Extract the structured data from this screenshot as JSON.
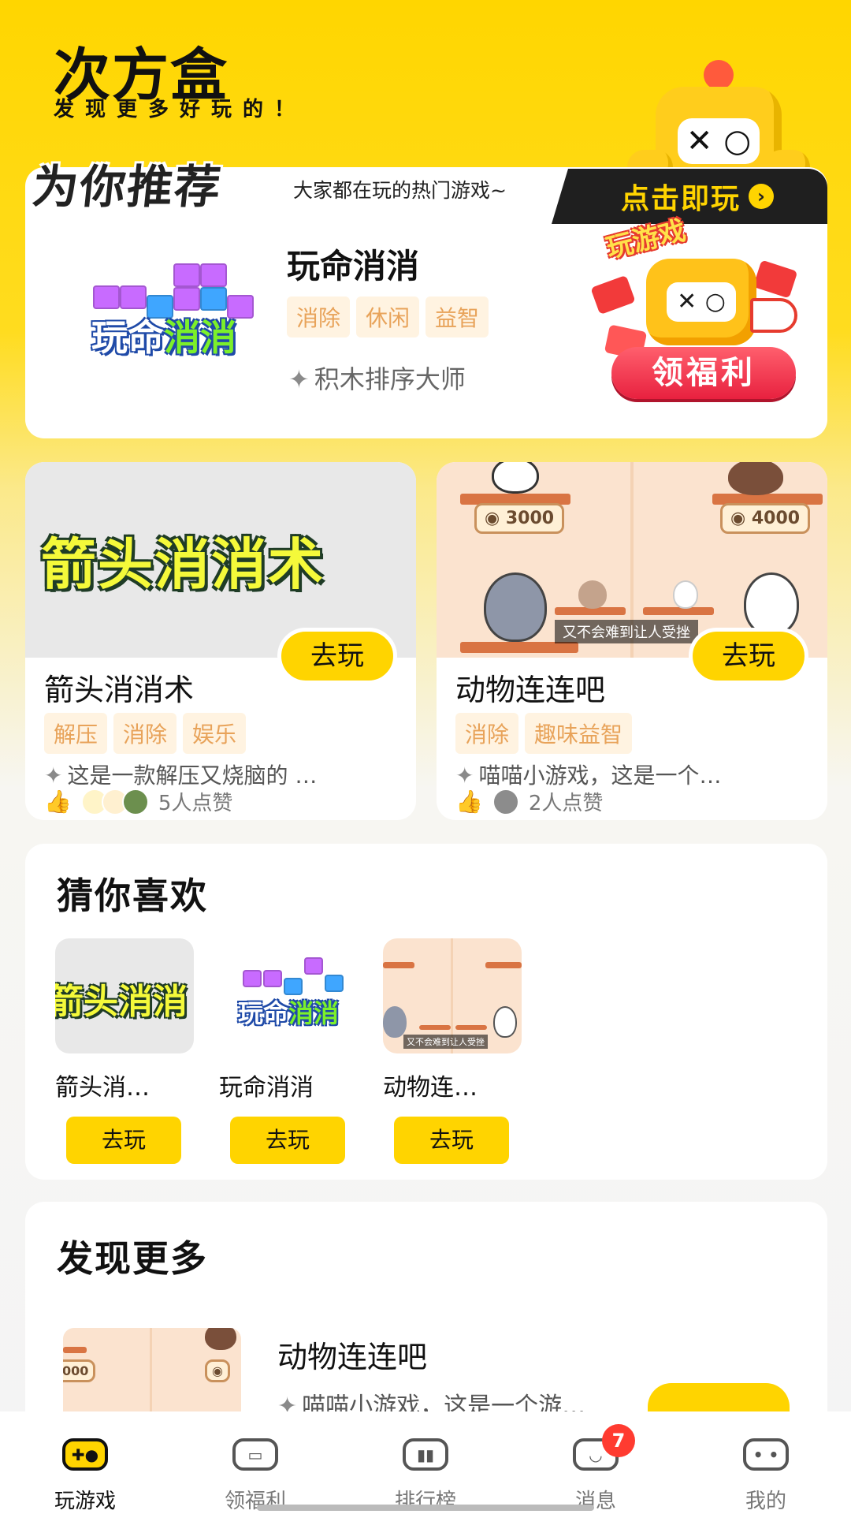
{
  "app": {
    "title": "次方盒",
    "slogan": "发现更多好玩的！"
  },
  "mascot": {
    "face": "✕ ○"
  },
  "recommend": {
    "badge": "为你推荐",
    "subtitle": "大家都在玩的热门游戏~",
    "play_banner": "点击即玩",
    "game": {
      "name": "玩命消消",
      "logo_text_1": "玩命",
      "logo_text_2": "消消",
      "tags": [
        "消除",
        "休闲",
        "益智"
      ],
      "desc": "积木排序大师"
    },
    "promo": {
      "tilted_text": "玩游戏",
      "button": "领福利",
      "face": "✕ ○"
    }
  },
  "games": [
    {
      "cover_title": "箭头消消术",
      "name": "箭头消消术",
      "play": "去玩",
      "tags": [
        "解压",
        "消除",
        "娱乐"
      ],
      "desc": "这是一款解压又烧脑的 …",
      "likes": "5人点赞"
    },
    {
      "cover_coins": [
        "3000",
        "4000"
      ],
      "cover_caption": "又不会难到让人受挫",
      "name": "动物连连吧",
      "play": "去玩",
      "tags": [
        "消除",
        "趣味益智"
      ],
      "desc": "喵喵小游戏，这是一个…",
      "likes": "2人点赞"
    }
  ],
  "guess": {
    "title": "猜你喜欢",
    "items": [
      {
        "name": "箭头消…",
        "play": "去玩",
        "thumb_text": "箭头消消"
      },
      {
        "name": "玩命消消",
        "play": "去玩",
        "thumb_text_1": "玩命",
        "thumb_text_2": "消消"
      },
      {
        "name": "动物连…",
        "play": "去玩",
        "thumb_caption": "又不会难到让人受挫"
      }
    ]
  },
  "discover": {
    "title": "发现更多",
    "item": {
      "name": "动物连连吧",
      "desc": "喵喵小游戏，这是一个游…"
    }
  },
  "nav": {
    "items": [
      {
        "label": "玩游戏",
        "icon": "gamepad-icon",
        "glyph": "✚●"
      },
      {
        "label": "领福利",
        "icon": "gift-icon",
        "glyph": "▭"
      },
      {
        "label": "排行榜",
        "icon": "ranking-icon",
        "glyph": "▮▮"
      },
      {
        "label": "消息",
        "icon": "message-icon",
        "glyph": "◡",
        "badge": "7"
      },
      {
        "label": "我的",
        "icon": "profile-icon",
        "glyph": "• •"
      }
    ]
  },
  "colors": {
    "brand_yellow": "#FFD400",
    "tag_bg": "#FFF3E1",
    "tag_text": "#E8A35A",
    "badge_red": "#FF3B30"
  }
}
